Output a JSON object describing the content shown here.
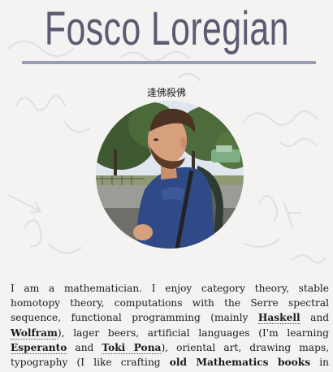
{
  "header": {
    "title": "Fosco Loregian",
    "cjk_name": "逢佛殺佛"
  },
  "avatar": {
    "icon": "portrait-photo"
  },
  "bio": {
    "p1": "I am a mathematician. I enjoy category theory, stable homotopy theory, computations with the Serre spectral sequence, functional programming (mainly ",
    "haskell": "Haskell",
    "and1": " and ",
    "wolfram": "Wolfram",
    "p2": "), lager beers, artificial languages (I'm learning ",
    "esperanto": "Esperanto",
    "and2": " and ",
    "toki_pona": "Toki Pona",
    "p3": "), oriental art, drawing maps, typography (I like crafting ",
    "old_math_books": "old Mathematics books",
    "p4": " in XeLaTeX), and linking all these things."
  },
  "colors": {
    "title": "#5b5b73",
    "rule": "#9c9bb5",
    "background": "#f4f3f2"
  }
}
